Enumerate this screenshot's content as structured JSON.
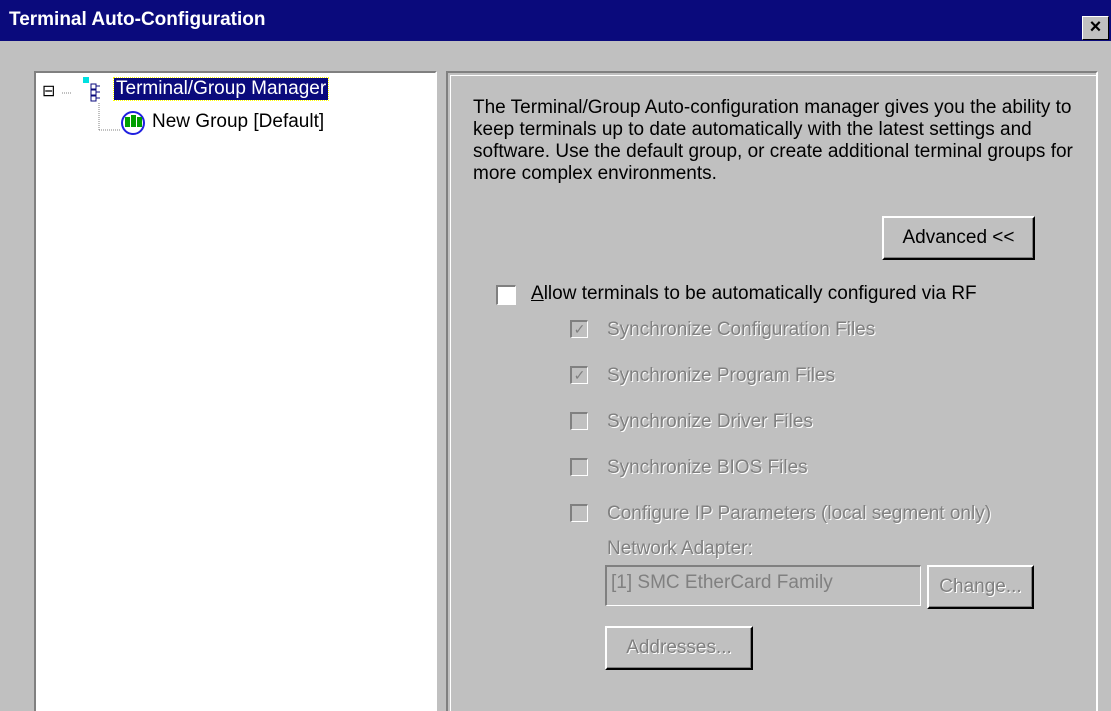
{
  "window": {
    "title": "Terminal Auto-Configuration",
    "close_label": "×"
  },
  "tree": {
    "root_label": "Terminal/Group Manager",
    "root_toggle": "⊟",
    "child_label": "New Group [Default]"
  },
  "panel": {
    "description": "The Terminal/Group Auto-configuration manager gives you the ability to keep terminals up to date automatically with the latest settings and software.  Use the default group, or create additional terminal groups for more complex environments.",
    "advanced_label": "Advanced <<",
    "allow_rf_label": "Allow terminals to be automatically configured via RF",
    "allow_rf_checked": false,
    "options": [
      {
        "label": "Synchronize Configuration Files",
        "checked": true
      },
      {
        "label": "Synchronize Program Files",
        "checked": true
      },
      {
        "label": "Synchronize Driver Files",
        "checked": false
      },
      {
        "label": "Synchronize BIOS Files",
        "checked": false
      },
      {
        "label": "Configure IP Parameters (local segment only)",
        "checked": false
      }
    ],
    "network_adapter_label": "Network Adapter:",
    "network_adapter_value": "[1] SMC EtherCard Family",
    "change_label": "Change...",
    "addresses_label": "Addresses..."
  },
  "colors": {
    "titlebar": "#0a0a7c",
    "face": "#c0c0c0",
    "disabled_text": "#808080"
  }
}
